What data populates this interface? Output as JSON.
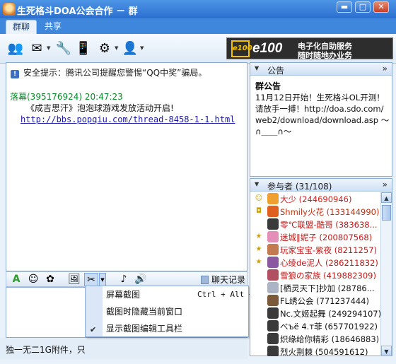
{
  "window": {
    "title": "生死格斗DOA公会合作 － 群",
    "min_label": "▬",
    "max_label": "□",
    "close_label": "✕"
  },
  "tabs": [
    {
      "label": "群聊",
      "active": true
    },
    {
      "label": "共享",
      "active": false
    }
  ],
  "toolbar_icons": [
    "members-icon",
    "mail-icon",
    "tools-icon",
    "mobile-icon",
    "settings-icon",
    "group-manage-icon"
  ],
  "ad": {
    "logo": "e100",
    "brand": "e100",
    "line1": "电子化自助服务",
    "line2": "随时随地办业务"
  },
  "chat": {
    "notice_label": "安全提示：腾讯公司提醒您警惕“QQ中奖”骗局。",
    "message": {
      "sender": "落幕(395176924) 20:47:23",
      "line1": "《成吉思汗》泡泡球游戏发放活动开启!",
      "link": "http://bbs.popqiu.com/thread-8458-1-1.html"
    }
  },
  "format_bar": {
    "icons": [
      "font-icon",
      "emoticon-icon",
      "magic-emoticon-icon",
      "send-image-icon",
      "screenshot-icon",
      "music-icon",
      "voice-icon"
    ],
    "history_label": "聊天记录"
  },
  "screenshot_menu": {
    "items": [
      {
        "label": "屏幕截图",
        "shortcut": "Ctrl + Alt + A",
        "checked": false
      },
      {
        "label": "截图时隐藏当前窗口",
        "shortcut": "",
        "checked": false
      },
      {
        "label": "显示截图编辑工具栏",
        "shortcut": "",
        "checked": true
      }
    ]
  },
  "footer": {
    "text": "独一无二1G附件，只"
  },
  "announcement": {
    "header": "公告",
    "title": "群公告",
    "body": "11月12日开始！生死格斗OL开测！请放手一搏！http://doa.sdo.com/web2/download/download.asp ～∩＿＿∩～"
  },
  "members": {
    "header": "参与者 (31/108)",
    "list": [
      {
        "name": "大少 (244690946)",
        "color": "#d02020",
        "role": "owner",
        "avatar": "#f0a030"
      },
      {
        "name": "Shmily火花 (133144990)",
        "color": "#c03010",
        "role": "admin",
        "avatar": "#e06020"
      },
      {
        "name": "零℃联盟-酷哥 (383638...",
        "color": "#c01818",
        "role": "",
        "avatar": "#3a3a3a"
      },
      {
        "name": "迷城‖妮子 (200807568)",
        "color": "#c01818",
        "role": "vip",
        "avatar": "#e48fb8"
      },
      {
        "name": "玩家宝宝-紫夜 (8211257)",
        "color": "#c01818",
        "role": "vip",
        "avatar": "#c27a50"
      },
      {
        "name": "心绫de泥人 (286211832)",
        "color": "#c01818",
        "role": "vip",
        "avatar": "#8a5aa0"
      },
      {
        "name": "雪狼の家族 (419882309)",
        "color": "#c01818",
        "role": "",
        "avatar": "#b05060"
      },
      {
        "name": "[栖灵天下]抄加 (28786...",
        "color": "#111111",
        "role": "",
        "avatar": "#aab4c4"
      },
      {
        "name": "FL绣公会 (771237444)",
        "color": "#111111",
        "role": "",
        "avatar": "#7b5a3a"
      },
      {
        "name": "Nc.文姬起舞 (249294107)",
        "color": "#111111",
        "role": "",
        "avatar": "#3a3a3a"
      },
      {
        "name": "べъё 4.т菲 (657701922)",
        "color": "#111111",
        "role": "",
        "avatar": "#3a3a3a"
      },
      {
        "name": "炽缘给你精彩 (18646883)",
        "color": "#111111",
        "role": "",
        "avatar": "#3a3a3a"
      },
      {
        "name": "烈火荆棘 (504591612)",
        "color": "#111111",
        "role": "",
        "avatar": "#3a3a3a"
      }
    ]
  }
}
